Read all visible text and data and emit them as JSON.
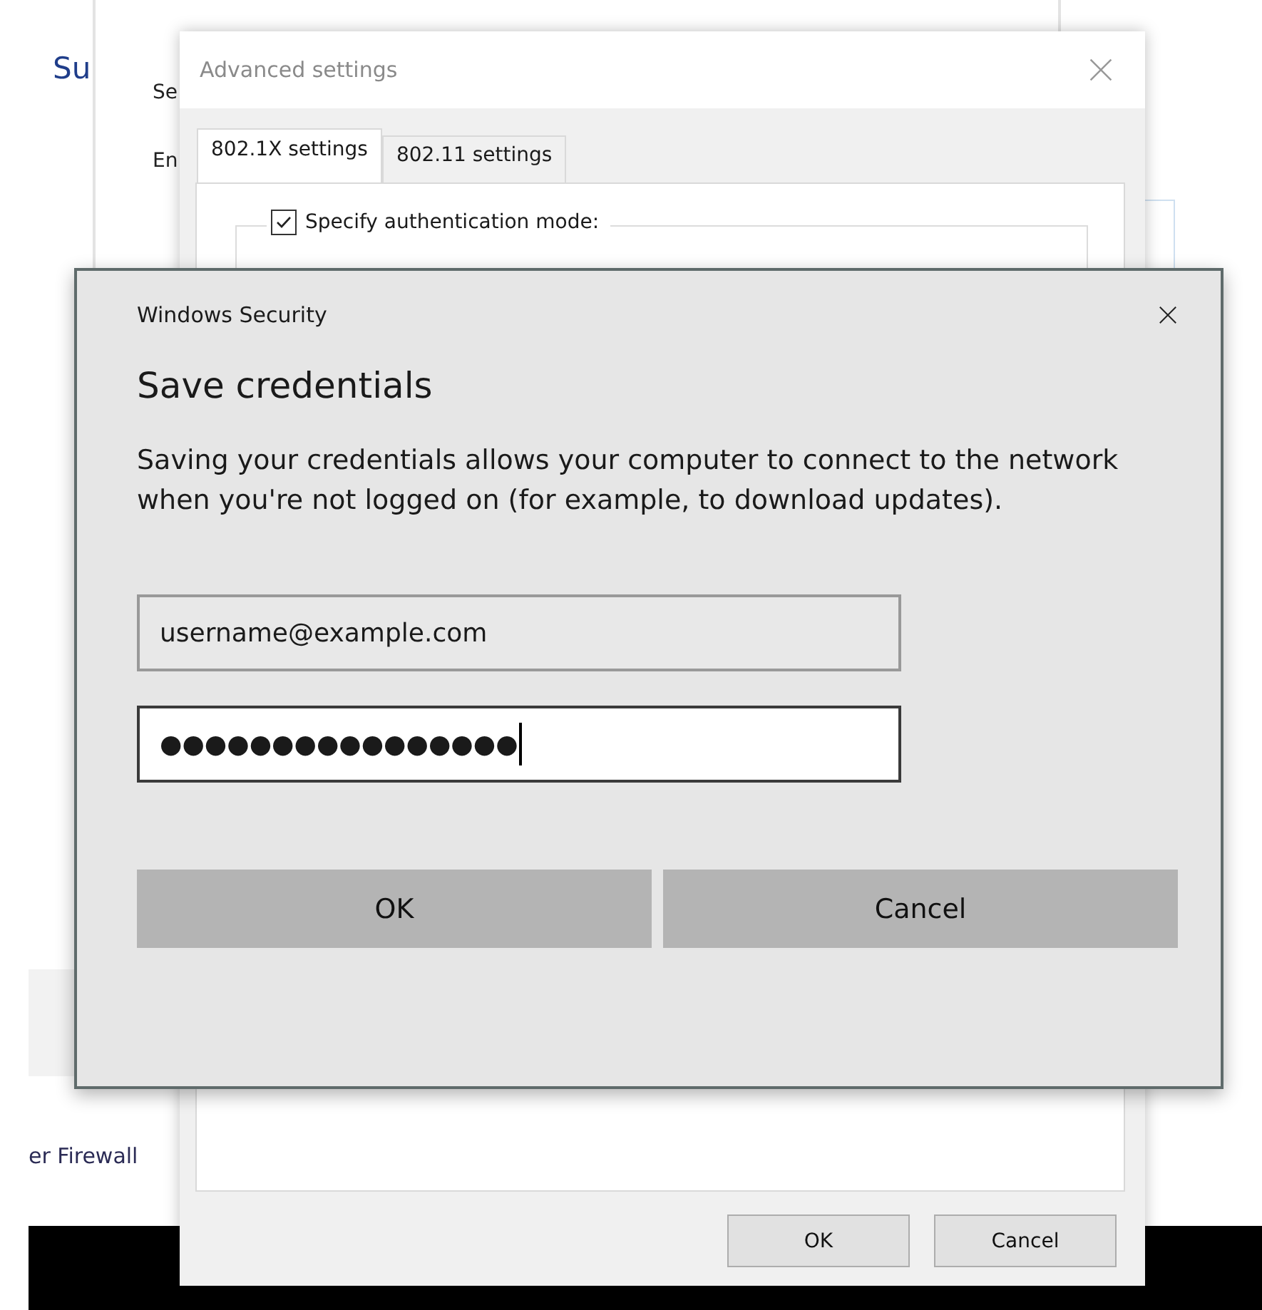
{
  "background_window": {
    "heading": "Su",
    "labels": [
      "Se",
      "En"
    ],
    "link": "er Firewall"
  },
  "advanced_settings": {
    "title": "Advanced settings",
    "tabs": [
      {
        "label": "802.1X settings",
        "selected": true
      },
      {
        "label": "802.11 settings",
        "selected": false
      }
    ],
    "auth_mode": {
      "label": "Specify authentication mode:",
      "checked": true
    },
    "buttons": [
      "OK",
      "Cancel"
    ]
  },
  "dialog": {
    "app_name": "Windows Security",
    "title": "Save credentials",
    "message": "Saving your credentials allows your computer to connect to the network when you're not logged on (for example, to download updates).",
    "username": {
      "value": "username@example.com",
      "focused": false
    },
    "password": {
      "value": "●●●●●●●●●●●●●●●●",
      "focused": true
    },
    "buttons": [
      "OK",
      "Cancel"
    ]
  }
}
